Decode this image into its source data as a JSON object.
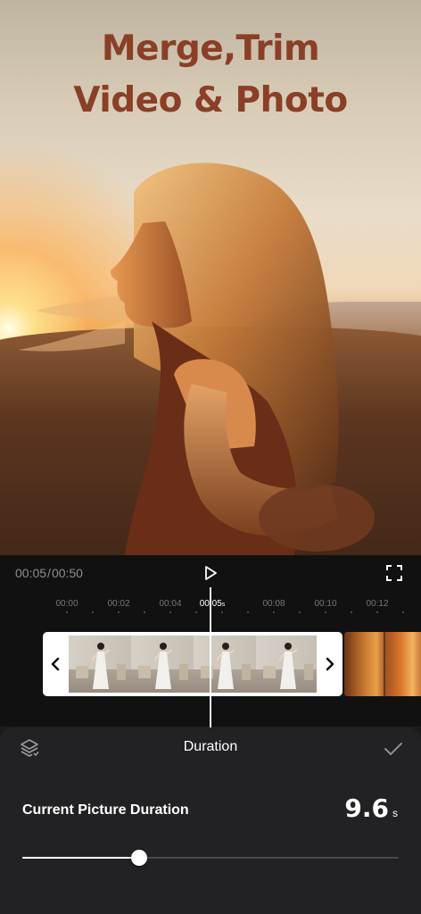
{
  "preview": {
    "headline_line1": "Merge,Trim",
    "headline_line2": "Video & Photo"
  },
  "playback": {
    "current_time": "00:05",
    "total_time": "00:50",
    "separator": "/"
  },
  "timeline": {
    "ticks": [
      "00:00",
      "00:02",
      "00:04",
      "00:05",
      "00:08",
      "00:10",
      "00:12"
    ],
    "active_tick": "00:05",
    "active_tick_suffix": "s",
    "frames_in_clip": 4,
    "playhead_time": "00:05"
  },
  "sheet": {
    "title": "Duration",
    "duration_label": "Current Picture Duration",
    "duration_value": "9.6",
    "duration_unit": "s",
    "slider_fraction": 0.31
  },
  "icons": {
    "play": "play-icon",
    "fullscreen": "fullscreen-icon",
    "layers": "layers-icon",
    "confirm": "checkmark-icon",
    "handle_left": "chevron-left-icon",
    "handle_right": "chevron-right-icon"
  },
  "colors": {
    "headline": "#8a3f26",
    "background": "#111111",
    "sheet": "#222224",
    "accent": "#ffffff"
  }
}
